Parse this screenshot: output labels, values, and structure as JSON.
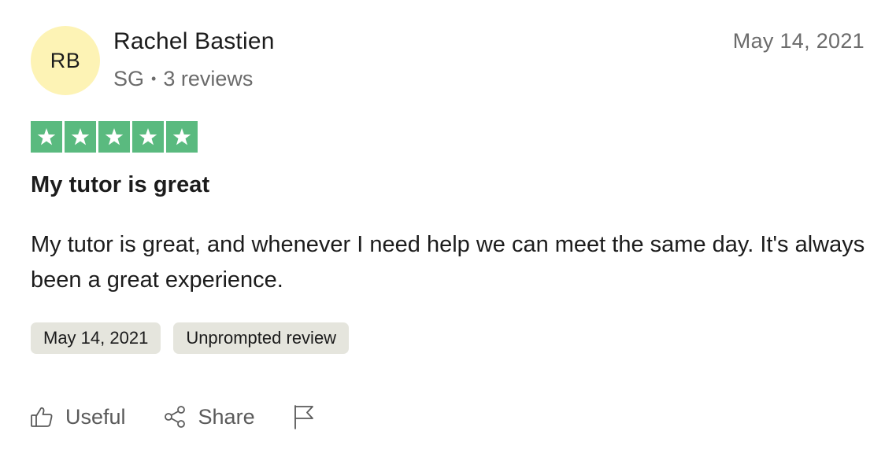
{
  "reviewer": {
    "initials": "RB",
    "name": "Rachel Bastien",
    "country": "SG",
    "separator": "•",
    "reviews_count": "3 reviews",
    "avatar_color": "#fdf3b5"
  },
  "review": {
    "date": "May 14, 2021",
    "rating": 5,
    "rating_max": 5,
    "star_color": "#5aba7f",
    "title": "My tutor is great",
    "body": "My tutor is great, and whenever I need help we can meet the same day. It's always been a great experience."
  },
  "tags": {
    "date_of_experience": "May 14, 2021",
    "review_type": "Unprompted review"
  },
  "actions": {
    "useful_label": "Useful",
    "useful_icon": "thumbs-up-icon",
    "share_label": "Share",
    "share_icon": "share-icon",
    "flag_icon": "flag-icon"
  }
}
